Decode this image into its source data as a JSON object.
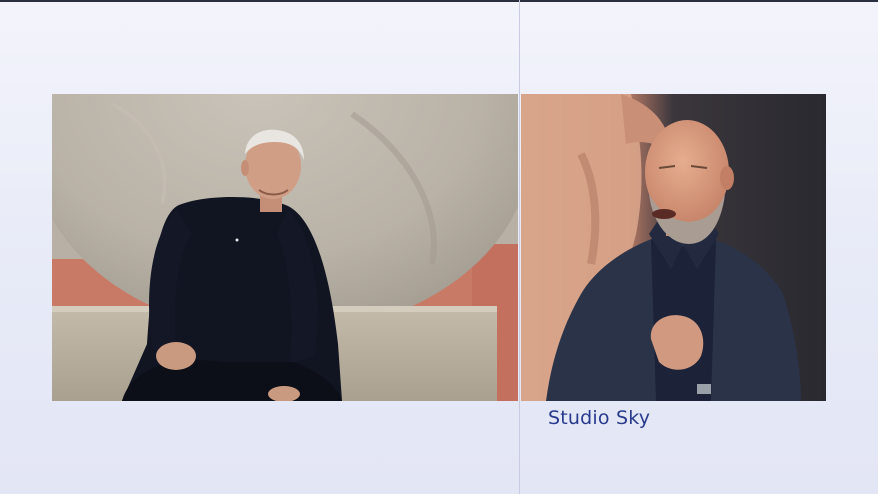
{
  "studio_label": "Studio Sky",
  "colors": {
    "label_color": "#283a8c",
    "background": "#eceef8"
  }
}
